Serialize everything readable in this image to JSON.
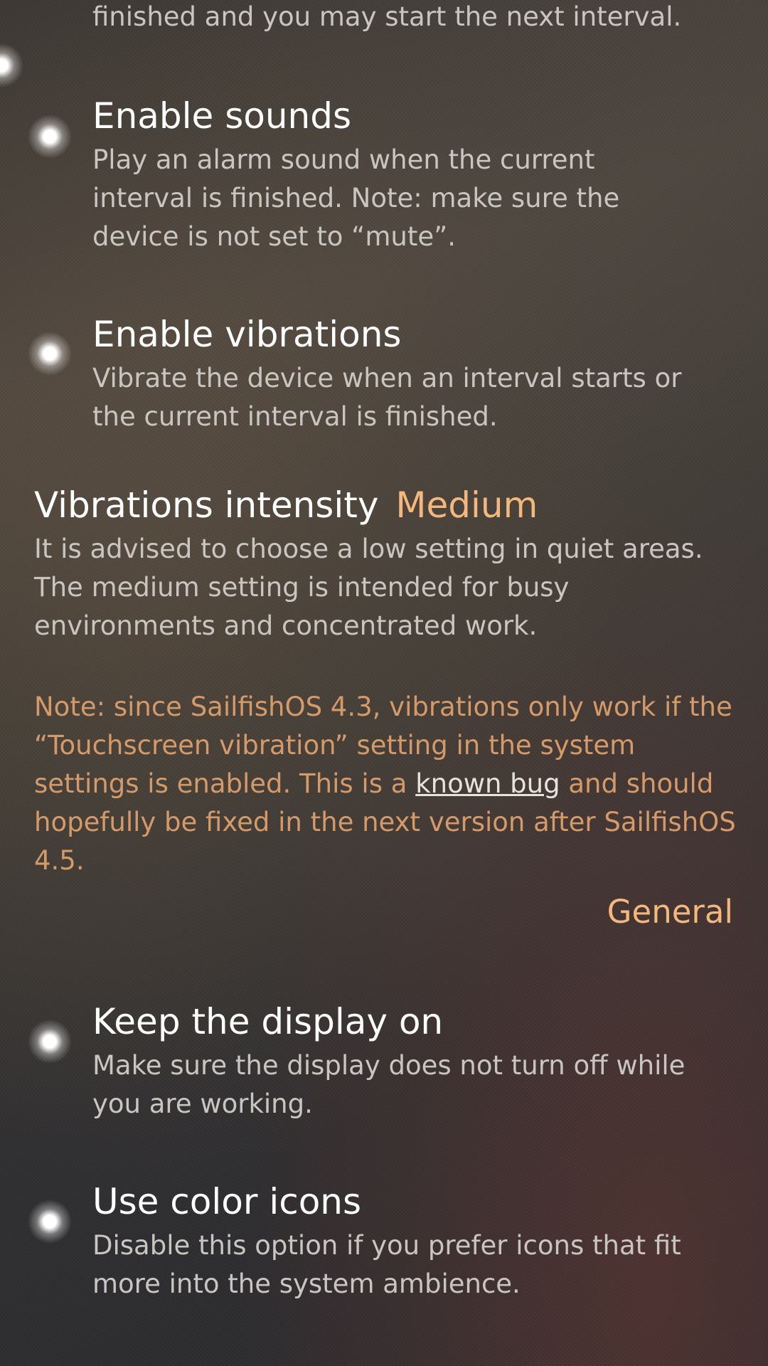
{
  "top_partial": {
    "text": "finished and you may start the next interval."
  },
  "sounds": {
    "title": "Enable sounds",
    "description": "Play an alarm sound when the current interval is finished. Note: make sure the device is not set to “mute”."
  },
  "vibrations": {
    "title": "Enable vibrations",
    "description": "Vibrate the device when an interval starts or the current interval is finished."
  },
  "intensity": {
    "label": "Vibrations intensity",
    "value": "Medium",
    "description": "It is advised to choose a low setting in quiet areas. The medium setting is intended for busy environments and concentrated work."
  },
  "note": {
    "before_link": "Note: since SailfishOS 4.3, vibrations only work if the “Touchscreen vibration” setting in the system settings is enabled. This is a ",
    "link": "known bug",
    "after_link": " and should hopefully be fixed in the next version after SailfishOS 4.5."
  },
  "section_header": "General",
  "display": {
    "title": "Keep the display on",
    "description": "Make sure the display does not turn off while you are working."
  },
  "color_icons": {
    "title": "Use color icons",
    "description": "Disable this option if you prefer icons that fit more into the system ambience."
  },
  "colors": {
    "highlight": "#f4b87d",
    "warning": "#d59a6a"
  }
}
